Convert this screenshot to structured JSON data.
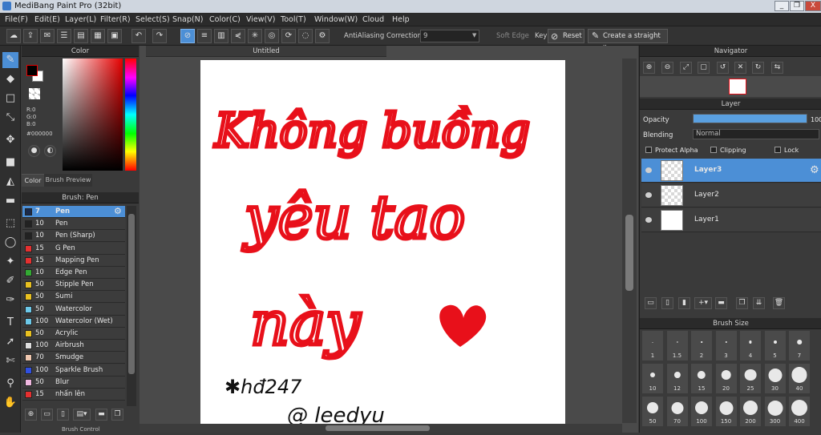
{
  "window": {
    "title": "MediBang Paint Pro (32bit)",
    "minimize": "_",
    "restore": "❐",
    "close": "X"
  },
  "menu": [
    "File(F)",
    "Edit(E)",
    "Layer(L)",
    "Filter(R)",
    "Select(S)",
    "Snap(N)",
    "Color(C)",
    "View(V)",
    "Tool(T)",
    "Window(W)",
    "Cloud",
    "Help"
  ],
  "toolbar": {
    "antialiasing_label": "AntiAliasing",
    "correction_label": "Correction",
    "correction_value": "9",
    "softedge_label": "Soft Edge",
    "key_label": "Key",
    "reset_label": "Reset",
    "straight_line_label": "Create a straight line"
  },
  "color_panel": {
    "title": "Color",
    "r": "R:0",
    "g": "G:0",
    "b": "B:0",
    "hex": "#000000",
    "tab_color": "Color",
    "tab_preview": "Brush Preview",
    "fg": "#000000",
    "bg": "#ffffff",
    "accent": "#e60000"
  },
  "brush_panel": {
    "title": "Brush: Pen",
    "brushes": [
      {
        "size": "7",
        "name": "Pen",
        "color": "#1a2a4a",
        "selected": true
      },
      {
        "size": "10",
        "name": "Pen",
        "color": "#222222"
      },
      {
        "size": "10",
        "name": "Pen (Sharp)",
        "color": "#222222"
      },
      {
        "size": "15",
        "name": "G Pen",
        "color": "#e53030"
      },
      {
        "size": "15",
        "name": "Mapping Pen",
        "color": "#e53030"
      },
      {
        "size": "10",
        "name": "Edge Pen",
        "color": "#33aa33"
      },
      {
        "size": "50",
        "name": "Stipple Pen",
        "color": "#e8c020"
      },
      {
        "size": "50",
        "name": "Sumi",
        "color": "#e8c020"
      },
      {
        "size": "50",
        "name": "Watercolor",
        "color": "#6cc8e8"
      },
      {
        "size": "100",
        "name": "Watercolor (Wet)",
        "color": "#6cc8e8"
      },
      {
        "size": "50",
        "name": "Acrylic",
        "color": "#e8c020"
      },
      {
        "size": "100",
        "name": "Airbrush",
        "color": "#dddddd"
      },
      {
        "size": "70",
        "name": "Smudge",
        "color": "#f0c8b0"
      },
      {
        "size": "100",
        "name": "Sparkle Brush",
        "color": "#3050e0"
      },
      {
        "size": "50",
        "name": "Blur",
        "color": "#f0b8e0"
      },
      {
        "size": "15",
        "name": "nhấn lên",
        "color": "#e53030"
      }
    ],
    "bottom_tab": "Brush Control"
  },
  "canvas": {
    "tab_title": "Untitled",
    "line1": "Không buồng",
    "line2": "yêu tao",
    "line3": "này",
    "sig1": "✱hđ247",
    "sig2": "@ leedyu",
    "ink": "#e8101a"
  },
  "navigator": {
    "title": "Navigator"
  },
  "layer_panel": {
    "title": "Layer",
    "opacity_label": "Opacity",
    "opacity_value": "100",
    "opacity": 1.0,
    "blending_label": "Blending",
    "blending_value": "Normal",
    "protect_alpha": "Protect Alpha",
    "clipping": "Clipping",
    "lock": "Lock",
    "layers": [
      {
        "name": "Layer3",
        "selected": true
      },
      {
        "name": "Layer2"
      },
      {
        "name": "Layer1"
      }
    ]
  },
  "brush_size_panel": {
    "title": "Brush Size",
    "row1": [
      "1",
      "1.5",
      "2",
      "3",
      "4",
      "5",
      "7"
    ],
    "row2": [
      "10",
      "12",
      "15",
      "20",
      "25",
      "30",
      "40"
    ],
    "row3": [
      "50",
      "70",
      "100",
      "150",
      "200",
      "300",
      "400"
    ]
  }
}
